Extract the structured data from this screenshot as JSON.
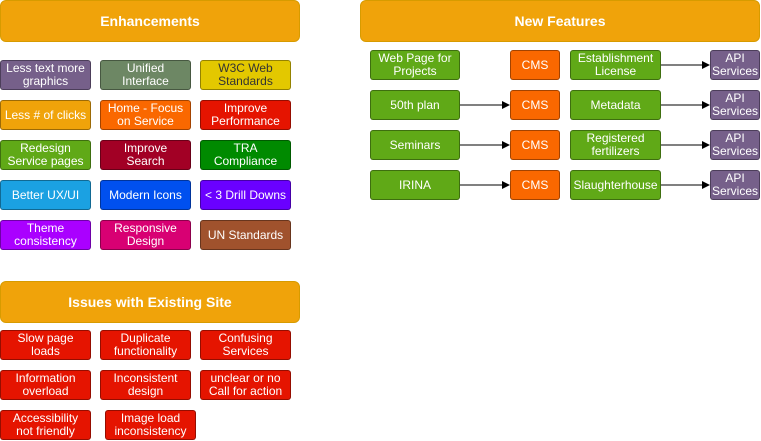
{
  "enhancements": {
    "title": "Enhancements",
    "items": [
      {
        "label": "Less text more graphics",
        "color": "#76608a"
      },
      {
        "label": "Unified Interface",
        "color": "#6d8764"
      },
      {
        "label": "W3C Web Standards",
        "color": "#e3c800"
      },
      {
        "label": "Less # of clicks",
        "color": "#f0a30a"
      },
      {
        "label": "Home - Focus on Service",
        "color": "#fa6800"
      },
      {
        "label": "Improve Performance",
        "color": "#e51400"
      },
      {
        "label": "Redesign Service pages",
        "color": "#60a917"
      },
      {
        "label": "Improve Search",
        "color": "#a20025"
      },
      {
        "label": "TRA Compliance",
        "color": "#008a00"
      },
      {
        "label": "Better UX/UI",
        "color": "#1ba1e2"
      },
      {
        "label": "Modern Icons",
        "color": "#0050ef"
      },
      {
        "label": "< 3 Drill Downs",
        "color": "#6a00ff"
      },
      {
        "label": "Theme consistency",
        "color": "#aa00ff"
      },
      {
        "label": "Responsive Design",
        "color": "#d80073"
      },
      {
        "label": "UN Standards",
        "color": "#a0522d"
      }
    ]
  },
  "issues": {
    "title": "Issues with Existing Site",
    "items": [
      {
        "label": "Slow page loads"
      },
      {
        "label": "Duplicate functionality"
      },
      {
        "label": "Confusing Services"
      },
      {
        "label": "Information overload"
      },
      {
        "label": "Inconsistent design"
      },
      {
        "label": "unclear or no Call for action"
      },
      {
        "label": "Accessibility not friendly"
      },
      {
        "label": "Image load inconsistency"
      }
    ]
  },
  "new_features": {
    "title": "New Features",
    "rows": [
      {
        "source": "Web Page for Projects",
        "cms": "CMS",
        "feature": "Establishment License",
        "api": "API Services"
      },
      {
        "source": "50th plan",
        "cms": "CMS",
        "feature": "Metadata",
        "api": "API Services"
      },
      {
        "source": "Seminars",
        "cms": "CMS",
        "feature": "Registered fertilizers",
        "api": "API Services"
      },
      {
        "source": "IRINA",
        "cms": "CMS",
        "feature": "Slaughterhouse",
        "api": "API Services"
      }
    ]
  },
  "colors": {
    "header_orange": "#f0a30a",
    "green": "#60a917",
    "cms_orange": "#fa6800",
    "api_purple": "#76608a",
    "issue_red": "#e51400"
  }
}
